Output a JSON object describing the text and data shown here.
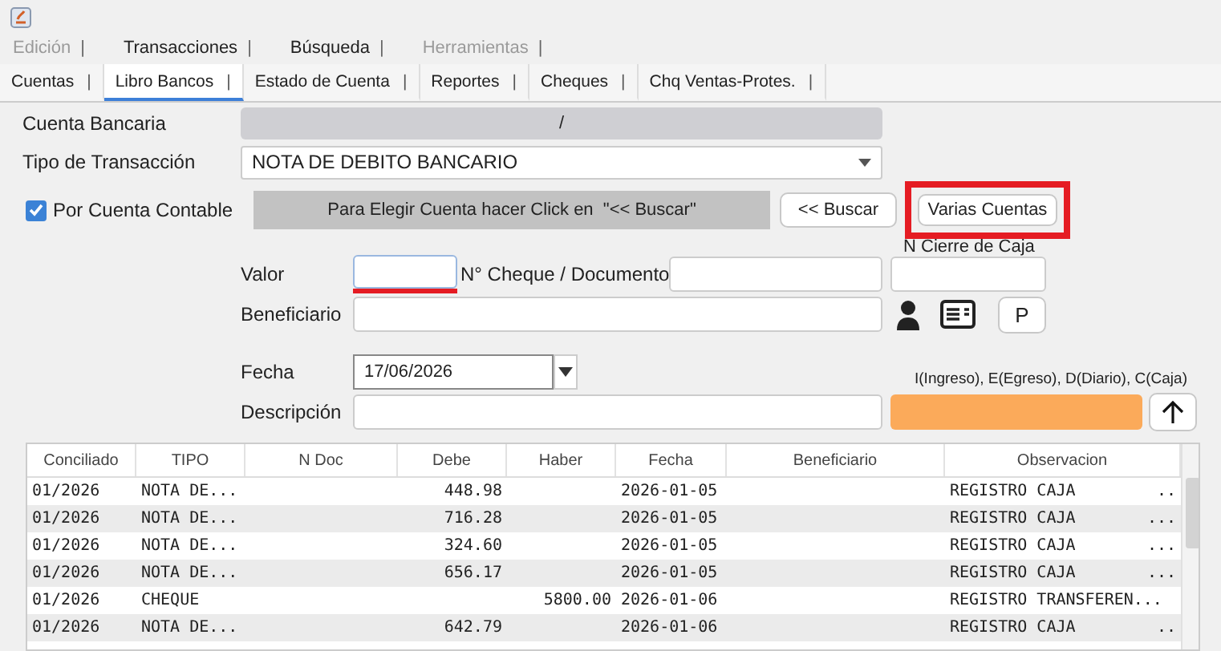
{
  "menu": [
    {
      "label": "Edición",
      "sep": "|",
      "disabled": true
    },
    {
      "label": "Transacciones",
      "sep": "|",
      "disabled": false
    },
    {
      "label": "Búsqueda",
      "sep": "|",
      "disabled": false
    },
    {
      "label": "Herramientas",
      "sep": "|",
      "disabled": true
    }
  ],
  "tabs": [
    {
      "label": "Cuentas",
      "sep": "|",
      "selected": false
    },
    {
      "label": "Libro Bancos",
      "sep": "|",
      "selected": true
    },
    {
      "label": "Estado de Cuenta",
      "sep": "|",
      "selected": false
    },
    {
      "label": "Reportes",
      "sep": "|",
      "selected": false
    },
    {
      "label": "Cheques",
      "sep": "|",
      "selected": false
    },
    {
      "label": "Chq Ventas-Protes.",
      "sep": "|",
      "selected": false
    }
  ],
  "form": {
    "cuenta_label": "Cuenta Bancaria",
    "cuenta_value": "/",
    "tipo_label": "Tipo de Transacción",
    "tipo_value": "NOTA DE DEBITO BANCARIO",
    "por_cuenta": {
      "label": "Por Cuenta Contable",
      "checked": true
    },
    "hint": "Para Elegir Cuenta hacer Click en  \"<< Buscar\"",
    "buscar": "<< Buscar",
    "varias": {
      "label": "Varias Cuentas",
      "highlighted": true
    },
    "cierre_label": "N Cierre de Caja",
    "valor_label": "Valor",
    "valor_highlighted": true,
    "cheque_label": "N° Cheque / Documento",
    "beneficiario_label": "Beneficiario",
    "p_button": "P",
    "fecha_label": "Fecha",
    "fecha_value": "17/06/2026",
    "legend": "I(Ingreso), E(Egreso), D(Diario), C(Caja)",
    "descripcion_label": "Descripción"
  },
  "table": {
    "columns": [
      "Conciliado",
      "TIPO",
      "N Doc",
      "Debe",
      "Haber",
      "Fecha",
      "Beneficiario",
      "Observacion"
    ],
    "rows": [
      {
        "conciliado": "01/2026",
        "tipo": "NOTA DE...",
        "debe": "448.98",
        "haber": "",
        "fecha": "2026-01-05",
        "observacion": "REGISTRO CAJA",
        "tail": ".."
      },
      {
        "conciliado": "01/2026",
        "tipo": "NOTA DE...",
        "debe": "716.28",
        "haber": "",
        "fecha": "2026-01-05",
        "observacion": "REGISTRO CAJA",
        "tail": "..."
      },
      {
        "conciliado": "01/2026",
        "tipo": "NOTA DE...",
        "debe": "324.60",
        "haber": "",
        "fecha": "2026-01-05",
        "observacion": "REGISTRO CAJA",
        "tail": "..."
      },
      {
        "conciliado": "01/2026",
        "tipo": "NOTA DE...",
        "debe": "656.17",
        "haber": "",
        "fecha": "2026-01-05",
        "observacion": "REGISTRO CAJA",
        "tail": "..."
      },
      {
        "conciliado": "01/2026",
        "tipo": "CHEQUE",
        "debe": "",
        "haber": "5800.00",
        "fecha": "2026-01-06",
        "observacion": "REGISTRO TRANSFEREN...",
        "tail": ""
      },
      {
        "conciliado": "01/2026",
        "tipo": "NOTA DE...",
        "debe": "642.79",
        "haber": "",
        "fecha": "2026-01-06",
        "observacion": "REGISTRO CAJA",
        "tail": ".."
      }
    ]
  }
}
